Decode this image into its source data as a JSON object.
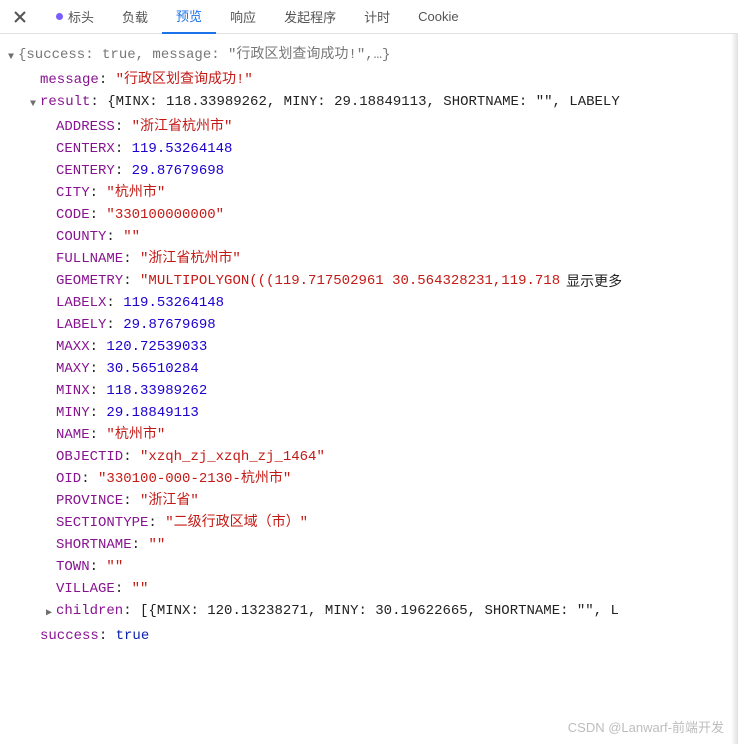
{
  "tabs": {
    "t0": "标头",
    "t1": "负载",
    "t2": "预览",
    "t3": "响应",
    "t4": "发起程序",
    "t5": "计时",
    "t6": "Cookie"
  },
  "root_line": "{success: true, message: \"行政区划查询成功!\",…}",
  "message_key": "message",
  "message_val": "\"行政区划查询成功!\"",
  "result_key": "result",
  "result_preview": "{MINX: 118.33989262, MINY: 29.18849113, SHORTNAME: \"\", LABELY",
  "fields": {
    "ADDRESS": {
      "k": "ADDRESS",
      "v": "\"浙江省杭州市\"",
      "t": "str"
    },
    "CENTERX": {
      "k": "CENTERX",
      "v": "119.53264148",
      "t": "num"
    },
    "CENTERY": {
      "k": "CENTERY",
      "v": "29.87679698",
      "t": "num"
    },
    "CITY": {
      "k": "CITY",
      "v": "\"杭州市\"",
      "t": "str"
    },
    "CODE": {
      "k": "CODE",
      "v": "\"330100000000\"",
      "t": "str"
    },
    "COUNTY": {
      "k": "COUNTY",
      "v": "\"\"",
      "t": "str"
    },
    "FULLNAME": {
      "k": "FULLNAME",
      "v": "\"浙江省杭州市\"",
      "t": "str"
    },
    "GEOMETRY": {
      "k": "GEOMETRY",
      "v": "\"MULTIPOLYGON(((119.717502961 30.564328231,119.718",
      "t": "str"
    },
    "LABELX": {
      "k": "LABELX",
      "v": "119.53264148",
      "t": "num"
    },
    "LABELY": {
      "k": "LABELY",
      "v": "29.87679698",
      "t": "num"
    },
    "MAXX": {
      "k": "MAXX",
      "v": "120.72539033",
      "t": "num"
    },
    "MAXY": {
      "k": "MAXY",
      "v": "30.56510284",
      "t": "num"
    },
    "MINX": {
      "k": "MINX",
      "v": "118.33989262",
      "t": "num"
    },
    "MINY": {
      "k": "MINY",
      "v": "29.18849113",
      "t": "num"
    },
    "NAME": {
      "k": "NAME",
      "v": "\"杭州市\"",
      "t": "str"
    },
    "OBJECTID": {
      "k": "OBJECTID",
      "v": "\"xzqh_zj_xzqh_zj_1464\"",
      "t": "str"
    },
    "OID": {
      "k": "OID",
      "v": "\"330100-000-2130-杭州市\"",
      "t": "str"
    },
    "PROVINCE": {
      "k": "PROVINCE",
      "v": "\"浙江省\"",
      "t": "str"
    },
    "SECTIONTYPE": {
      "k": "SECTIONTYPE",
      "v": "\"二级行政区域（市）\"",
      "t": "str"
    },
    "SHORTNAME": {
      "k": "SHORTNAME",
      "v": "\"\"",
      "t": "str"
    },
    "TOWN": {
      "k": "TOWN",
      "v": "\"\"",
      "t": "str"
    },
    "VILLAGE": {
      "k": "VILLAGE",
      "v": "\"\"",
      "t": "str"
    }
  },
  "children_key": "children",
  "children_preview": "[{MINX: 120.13238271, MINY: 30.19622665, SHORTNAME: \"\", L",
  "success_key": "success",
  "success_val": "true",
  "show_more": "显示更多",
  "watermark": "CSDN @Lanwarf-前端开发"
}
